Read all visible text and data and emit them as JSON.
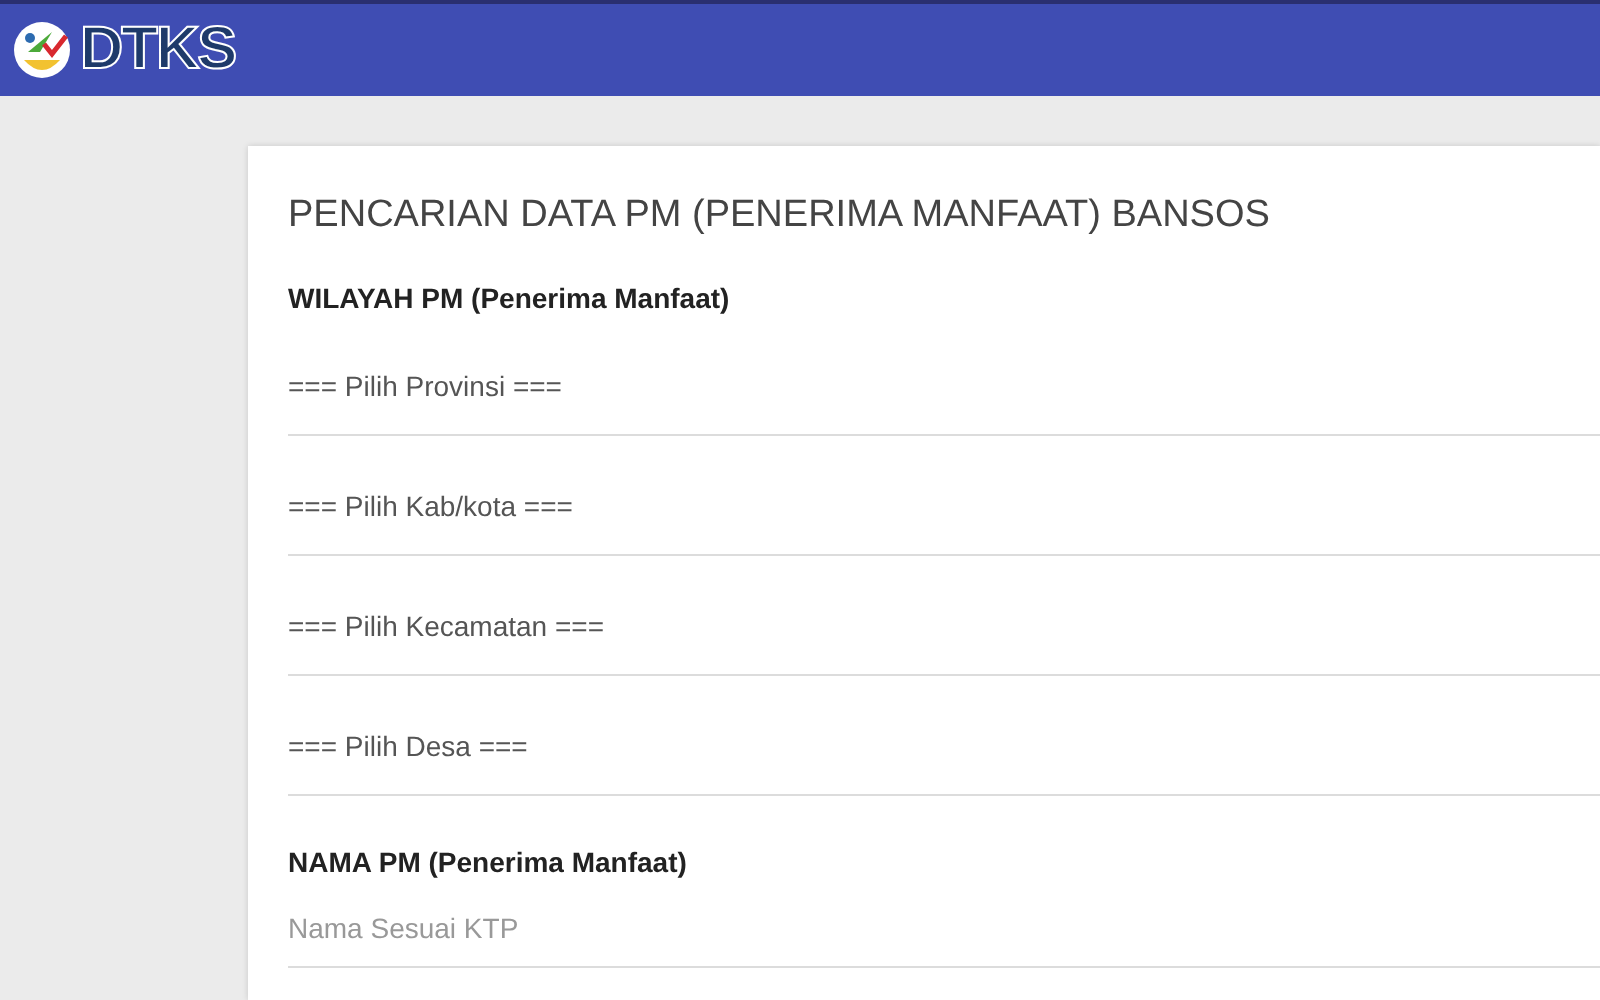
{
  "header": {
    "logo_text": "DTKS"
  },
  "form": {
    "title": "PENCARIAN DATA PM (PENERIMA MANFAAT) BANSOS",
    "region_heading": "WILAYAH PM (Penerima Manfaat)",
    "region_selects": [
      {
        "value": "=== Pilih Provinsi ==="
      },
      {
        "value": "=== Pilih Kab/kota ==="
      },
      {
        "value": "=== Pilih Kecamatan ==="
      },
      {
        "value": "=== Pilih Desa ==="
      }
    ],
    "name_heading": "NAMA PM (Penerima Manfaat)",
    "name_field": {
      "placeholder": "Nama Sesuai KTP"
    }
  }
}
